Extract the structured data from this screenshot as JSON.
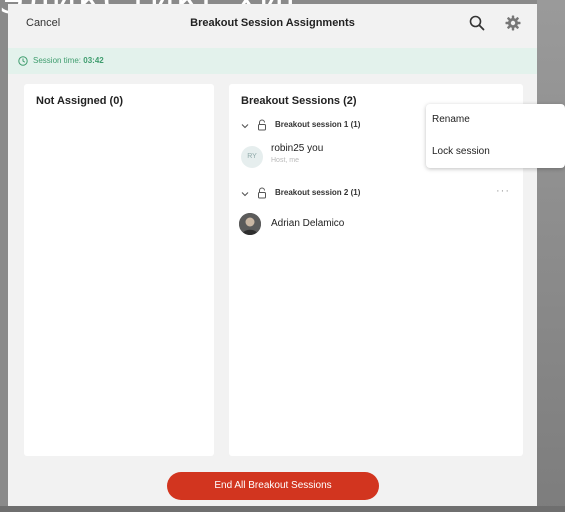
{
  "background": {
    "top_text": "ЭЛИКСТИКГ ХИГ"
  },
  "header": {
    "cancel_label": "Cancel",
    "title": "Breakout Session Assignments",
    "icons": [
      "search-icon",
      "gear-icon"
    ]
  },
  "session_time": {
    "label": "Session time:",
    "value": "03:42"
  },
  "left_panel": {
    "title": "Not Assigned (0)"
  },
  "right_panel": {
    "title": "Breakout Sessions (2)",
    "sessions": [
      {
        "label": "Breakout session 1 (1)",
        "participants": [
          {
            "initials": "RY",
            "name": "robin25 you",
            "role": "Host, me"
          }
        ]
      },
      {
        "label": "Breakout session 2 (1)",
        "more_label": "···",
        "participants": [
          {
            "name": "Adrian Delamico"
          }
        ]
      }
    ]
  },
  "context_menu": {
    "items": [
      "Rename",
      "Lock session"
    ]
  },
  "footer": {
    "end_button_label": "End All Breakout Sessions"
  },
  "colors": {
    "accent_red": "#d2351f",
    "time_bar_bg": "#e3f2ec",
    "time_text": "#3f9d6e"
  }
}
